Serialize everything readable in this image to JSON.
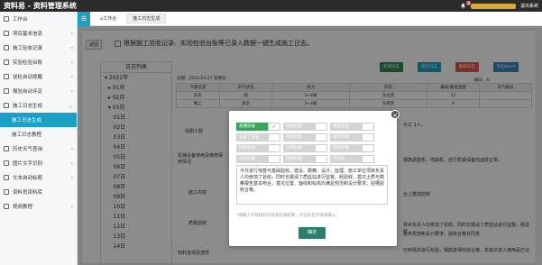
{
  "app": {
    "title": "资料易 - 资料管理系统",
    "notifications": "6",
    "logout": "退出系统"
  },
  "sidebar": {
    "items": [
      {
        "label": "工作台",
        "chev": ""
      },
      {
        "label": "项目基本信息",
        "chev": "‹"
      },
      {
        "label": "施工验收记录",
        "chev": "‹"
      },
      {
        "label": "实验检验台账",
        "chev": "‹"
      },
      {
        "label": "送检自动提醒",
        "chev": "‹"
      },
      {
        "label": "报验自动评定",
        "chev": "‹"
      },
      {
        "label": "施工日志生成",
        "chev": "⌄"
      },
      {
        "label": "施工日志生成",
        "chev": ""
      },
      {
        "label": "施工日志教程",
        "chev": ""
      },
      {
        "label": "历史天气查询",
        "chev": "‹"
      },
      {
        "label": "图片文字识别",
        "chev": "‹"
      },
      {
        "label": "文本自动标题",
        "chev": "‹"
      },
      {
        "label": "资料员资料库",
        "chev": ""
      },
      {
        "label": "视频教程",
        "chev": "‹"
      }
    ]
  },
  "tabs": {
    "toggle": "☰",
    "home": "工作台",
    "active": "施工日志生成"
  },
  "main": {
    "back": "返回",
    "notice": "根据施工验收记录、实验检验台账等已录入数据一键生成施工日志。",
    "diary_title": "日志列表",
    "tree": [
      "▾ 2022年",
      "  ▸ 01月",
      "  ▸ 02月",
      "  ▾ 03月",
      "     01日",
      "     02日",
      "     03日",
      "     04日",
      "     05日",
      "     06日",
      "     07日",
      "     08日",
      "     09日",
      "     10日",
      "     11日",
      "     12日",
      "     13日",
      "     14日"
    ],
    "date": "日期：2022-03-27 星期日",
    "number": "编号：6",
    "buttons": {
      "new": "新增日志",
      "save": "保存日志",
      "delete": "删除日志",
      "export": "导出word"
    },
    "table": {
      "headers": [
        "气象信息",
        "天气状况",
        "风力",
        "风向",
        "最高/最低温度",
        "天气编号"
      ],
      "rows": [
        [
          "白天",
          "阴",
          "3~4级",
          "东北风",
          "15",
          ""
        ],
        [
          "晚上",
          "多云",
          "3~4级",
          "东南风",
          "4",
          ""
        ]
      ]
    },
    "labels": {
      "attendance": "出勤人数",
      "machinery": "机械设备使用及维修保养情况",
      "content": "施工内容",
      "quality": "质量验收",
      "material": "材料进场及送检"
    },
    "fragments": {
      "workers": "木工 1人。",
      "machine": "钢筋调直机、弯曲机、自行机械设备均运转正常。",
      "content": "台上模测控制",
      "quality": "技术负责人均参加了验收，同时也邀请了质监站进行监督。经验收，",
      "quality2": "技术规范和设计要求，验收合格并同意",
      "material": "已到场并进行检验，钢筋进场检验合格，本批次进入使用品已记"
    }
  },
  "modal": {
    "checks": [
      {
        "label": "基槽验收",
        "on": true
      },
      {
        "label": "钢筋验收",
        "on": false
      },
      {
        "label": "模板验收",
        "on": false
      },
      {
        "label": "混凝土浇筑",
        "on": false
      },
      {
        "label": "砌体验收",
        "on": false
      },
      {
        "label": "抹灰验收",
        "on": false
      },
      {
        "label": "隐蔽验收",
        "on": false
      },
      {
        "label": "分项验收",
        "on": false
      },
      {
        "label": "其他验收",
        "on": false
      },
      {
        "label": "分部验收",
        "on": false
      },
      {
        "label": "回填验收",
        "on": false
      },
      {
        "label": "无验收",
        "on": false
      }
    ],
    "text": "今日进行地基与基础验收。建设、勘察、设计、监理、施工单位项目负责人均参加了验收，同时也邀请了质监站进行监督。经验收，基坑土质与勘察报告基本吻合，基坑位置、轴线和标高均满足规范和设计要求，验槽验收合格。",
    "hint": "*请输入今日报验内容及验收结果，点击标签可快速输入。",
    "ok": "确定"
  }
}
